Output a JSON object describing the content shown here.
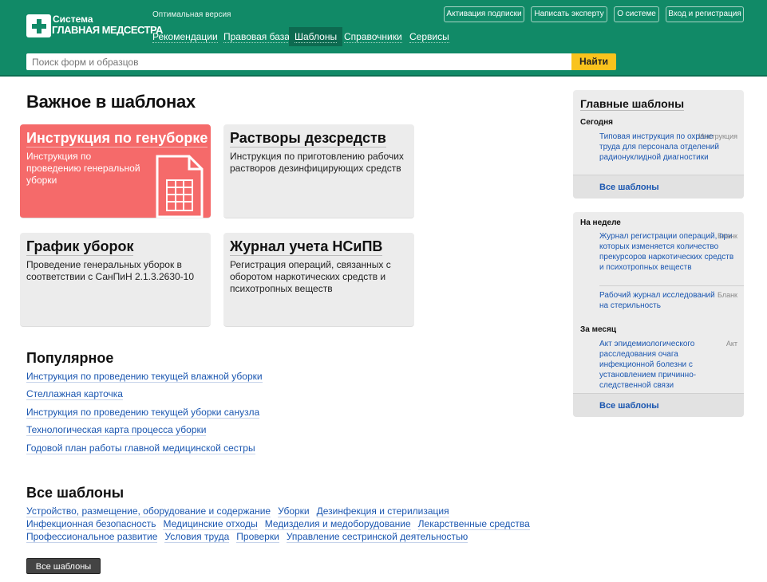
{
  "header": {
    "logo_line1": "Система",
    "logo_line2": "ГЛАВНАЯ МЕДСЕСТРА",
    "version": "Оптимальная версия",
    "top_buttons": [
      "Активация подписки",
      "Написать эксперту",
      "О системе",
      "Вход и регистрация"
    ],
    "nav": [
      "Рекомендации",
      "Правовая база",
      "Шаблоны",
      "Справочники",
      "Сервисы"
    ],
    "nav_active": "Шаблоны",
    "search_placeholder": "Поиск форм и образцов",
    "search_button": "Найти"
  },
  "main": {
    "title": "Важное в шаблонах",
    "cards": [
      {
        "title": "Инструкция по генуборке",
        "desc": "Инструкция по проведению генеральной уборки",
        "highlight": true
      },
      {
        "title": "Растворы дезсредств",
        "desc": "Инструкция по приготовлению рабочих растворов дезинфицирующих средств"
      },
      {
        "title": "График уборок",
        "desc": "Проведение генеральных уборок в соответствии с СанПиН 2.1.3.2630-10"
      },
      {
        "title": "Журнал учета НСиПВ",
        "desc": "Регистрация операций, связанных с оборотом наркотических средств и психотропных веществ"
      }
    ],
    "popular_title": "Популярное",
    "popular": [
      "Инструкция по проведению текущей влажной уборки",
      "Стеллажная карточка",
      "Инструкция по проведению текущей уборки санузла",
      "Технологическая карта процесса уборки",
      "Годовой план работы главной медицинской сестры"
    ],
    "all_title": "Все шаблоны",
    "categories": [
      [
        "Устройство, размещение, оборудование и содержание",
        "Уборки",
        "Дезинфекция и стерилизация"
      ],
      [
        "Инфекционная безопасность",
        "Медицинские отходы",
        "Медизделия и медоборудование",
        "Лекарственные средства"
      ],
      [
        "Профессиональное развитие",
        "Условия труда",
        "Проверки",
        "Управление сестринской деятельностью"
      ]
    ],
    "all_button": "Все шаблоны"
  },
  "sidebar": {
    "title": "Главные шаблоны",
    "today_label": "Сегодня",
    "today_items": [
      {
        "text": "Типовая инструкция по охране труда для персонала отделений радионуклидной диагностики",
        "tag": "Инструкция"
      }
    ],
    "all_link": "Все шаблоны",
    "week_label": "На неделе",
    "week_items": [
      {
        "text": "Журнал регистрации операций, при которых изменяется количество прекурсоров наркотических средств и психотропных веществ",
        "tag": "Бланк"
      },
      {
        "text": "Рабочий журнал исследований на стерильность",
        "tag": "Бланк"
      }
    ],
    "month_label": "За месяц",
    "month_items": [
      {
        "text": "Акт эпидемиологического расследования очага инфекционной болезни с установлением причинно-следственной связи",
        "tag": "Акт"
      }
    ],
    "all_link2": "Все шаблоны"
  },
  "colors": {
    "header": "#118a67",
    "accent_red": "#f56a6a",
    "search_button": "#f9c31d",
    "link": "#1a56b0"
  }
}
